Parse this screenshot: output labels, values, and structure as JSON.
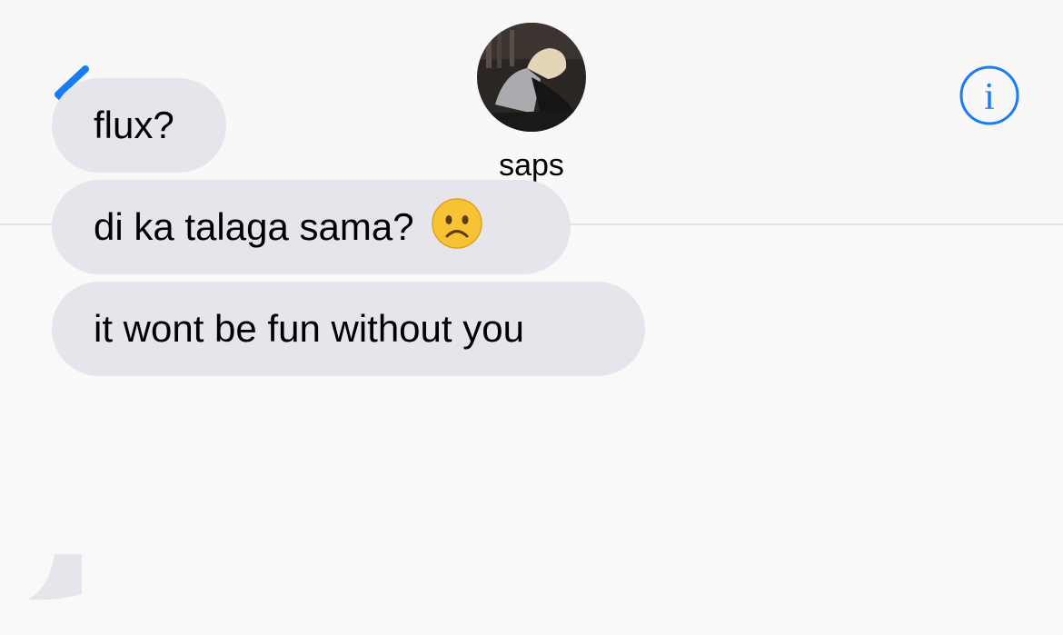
{
  "header": {
    "back_icon": "chevron-left-icon",
    "contact_name": "saps",
    "info_icon": "info-circle-icon",
    "accent_color": "#1a7cf5"
  },
  "messages": [
    {
      "direction": "incoming",
      "text": "flux?"
    },
    {
      "direction": "incoming",
      "text": "di ka talaga sama?",
      "emoji": "frowning-face-emoji"
    },
    {
      "direction": "incoming",
      "text": "it wont be fun without you"
    }
  ],
  "colors": {
    "incoming_bubble": "#e6e5eb",
    "background": "#f9f9f9"
  }
}
